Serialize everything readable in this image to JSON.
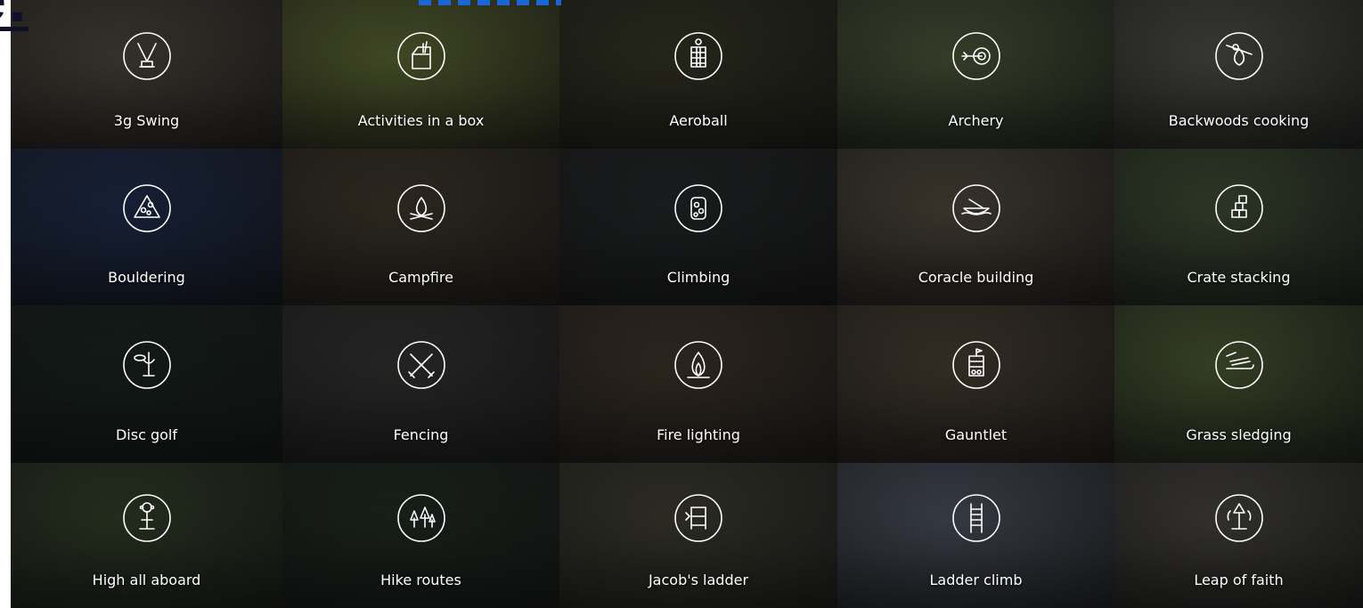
{
  "page": {
    "heading_fragment": "e:",
    "colors": {
      "heading": "#0d0f2b",
      "link_dots": "#1a66d8",
      "label": "#ffffff"
    }
  },
  "activities": [
    {
      "label": "3g Swing",
      "icon": "swing-icon",
      "bg": "#5a5248"
    },
    {
      "label": "Activities in a box",
      "icon": "box-icon",
      "bg": "#6d7a3c"
    },
    {
      "label": "Aeroball",
      "icon": "aeroball-icon",
      "bg": "#3e3f2c"
    },
    {
      "label": "Archery",
      "icon": "archery-target-icon",
      "bg": "#596744"
    },
    {
      "label": "Backwoods cooking",
      "icon": "cooking-fire-icon",
      "bg": "#5c5d57"
    },
    {
      "label": "Bouldering",
      "icon": "bouldering-wall-icon",
      "bg": "#24355a"
    },
    {
      "label": "Campfire",
      "icon": "campfire-icon",
      "bg": "#4a4234"
    },
    {
      "label": "Climbing",
      "icon": "climbing-hold-icon",
      "bg": "#2b2e30"
    },
    {
      "label": "Coracle building",
      "icon": "coracle-boat-icon",
      "bg": "#5e5648"
    },
    {
      "label": "Crate stacking",
      "icon": "crate-stack-icon",
      "bg": "#4b5b3f"
    },
    {
      "label": "Disc golf",
      "icon": "disc-golf-icon",
      "bg": "#1d2b26"
    },
    {
      "label": "Fencing",
      "icon": "fencing-swords-icon",
      "bg": "#3d3d3c"
    },
    {
      "label": "Fire lighting",
      "icon": "flame-icon",
      "bg": "#4a3e33"
    },
    {
      "label": "Gauntlet",
      "icon": "gauntlet-tower-icon",
      "bg": "#554a3c"
    },
    {
      "label": "Grass sledging",
      "icon": "sledge-icon",
      "bg": "#58693d"
    },
    {
      "label": "High all aboard",
      "icon": "high-all-aboard-icon",
      "bg": "#3b4a31"
    },
    {
      "label": "Hike routes",
      "icon": "forest-hike-icon",
      "bg": "#27332a"
    },
    {
      "label": "Jacob's ladder",
      "icon": "jacobs-ladder-icon",
      "bg": "#4a4a3c"
    },
    {
      "label": "Ladder climb",
      "icon": "ladder-icon",
      "bg": "#5a6170"
    },
    {
      "label": "Leap of faith",
      "icon": "leap-of-faith-icon",
      "bg": "#54524c"
    }
  ]
}
